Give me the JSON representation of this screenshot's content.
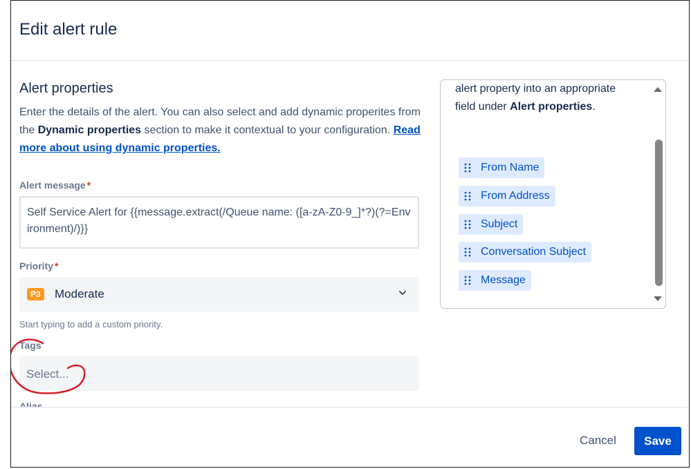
{
  "modal": {
    "title": "Edit alert rule"
  },
  "alert_properties": {
    "heading": "Alert properties",
    "description_part1": "Enter the details of the alert. You can also select and add dynamic properites from the ",
    "description_bold": "Dynamic properties",
    "description_part2": " section to make it contextual to your configuration. ",
    "description_link": "Read more about using dynamic properties."
  },
  "alert_message": {
    "label": "Alert message",
    "required_mark": "*",
    "value": "Self Service Alert for {{message.extract(/Queue name: ([a-zA-Z0-9_]*?)(?=Environment)/)}}"
  },
  "priority": {
    "label": "Priority",
    "required_mark": "*",
    "badge": "P3",
    "value": "Moderate",
    "helper": "Start typing to add a custom priority.",
    "badge_color": "#ff991f"
  },
  "tags": {
    "label": "Tags",
    "placeholder": "Select..."
  },
  "next_field_label_partial": "Alias",
  "dynamic_properties": {
    "text_part1": "alert property into an appropriate field under ",
    "text_bold": "Alert properties",
    "text_part2": ".",
    "chips": [
      {
        "label": "From Name"
      },
      {
        "label": "From Address"
      },
      {
        "label": "Subject"
      },
      {
        "label": "Conversation Subject"
      },
      {
        "label": "Message"
      }
    ]
  },
  "footer": {
    "cancel_label": "Cancel",
    "save_label": "Save",
    "save_color": "#0052cc"
  },
  "annotation_color": "#d9202a"
}
